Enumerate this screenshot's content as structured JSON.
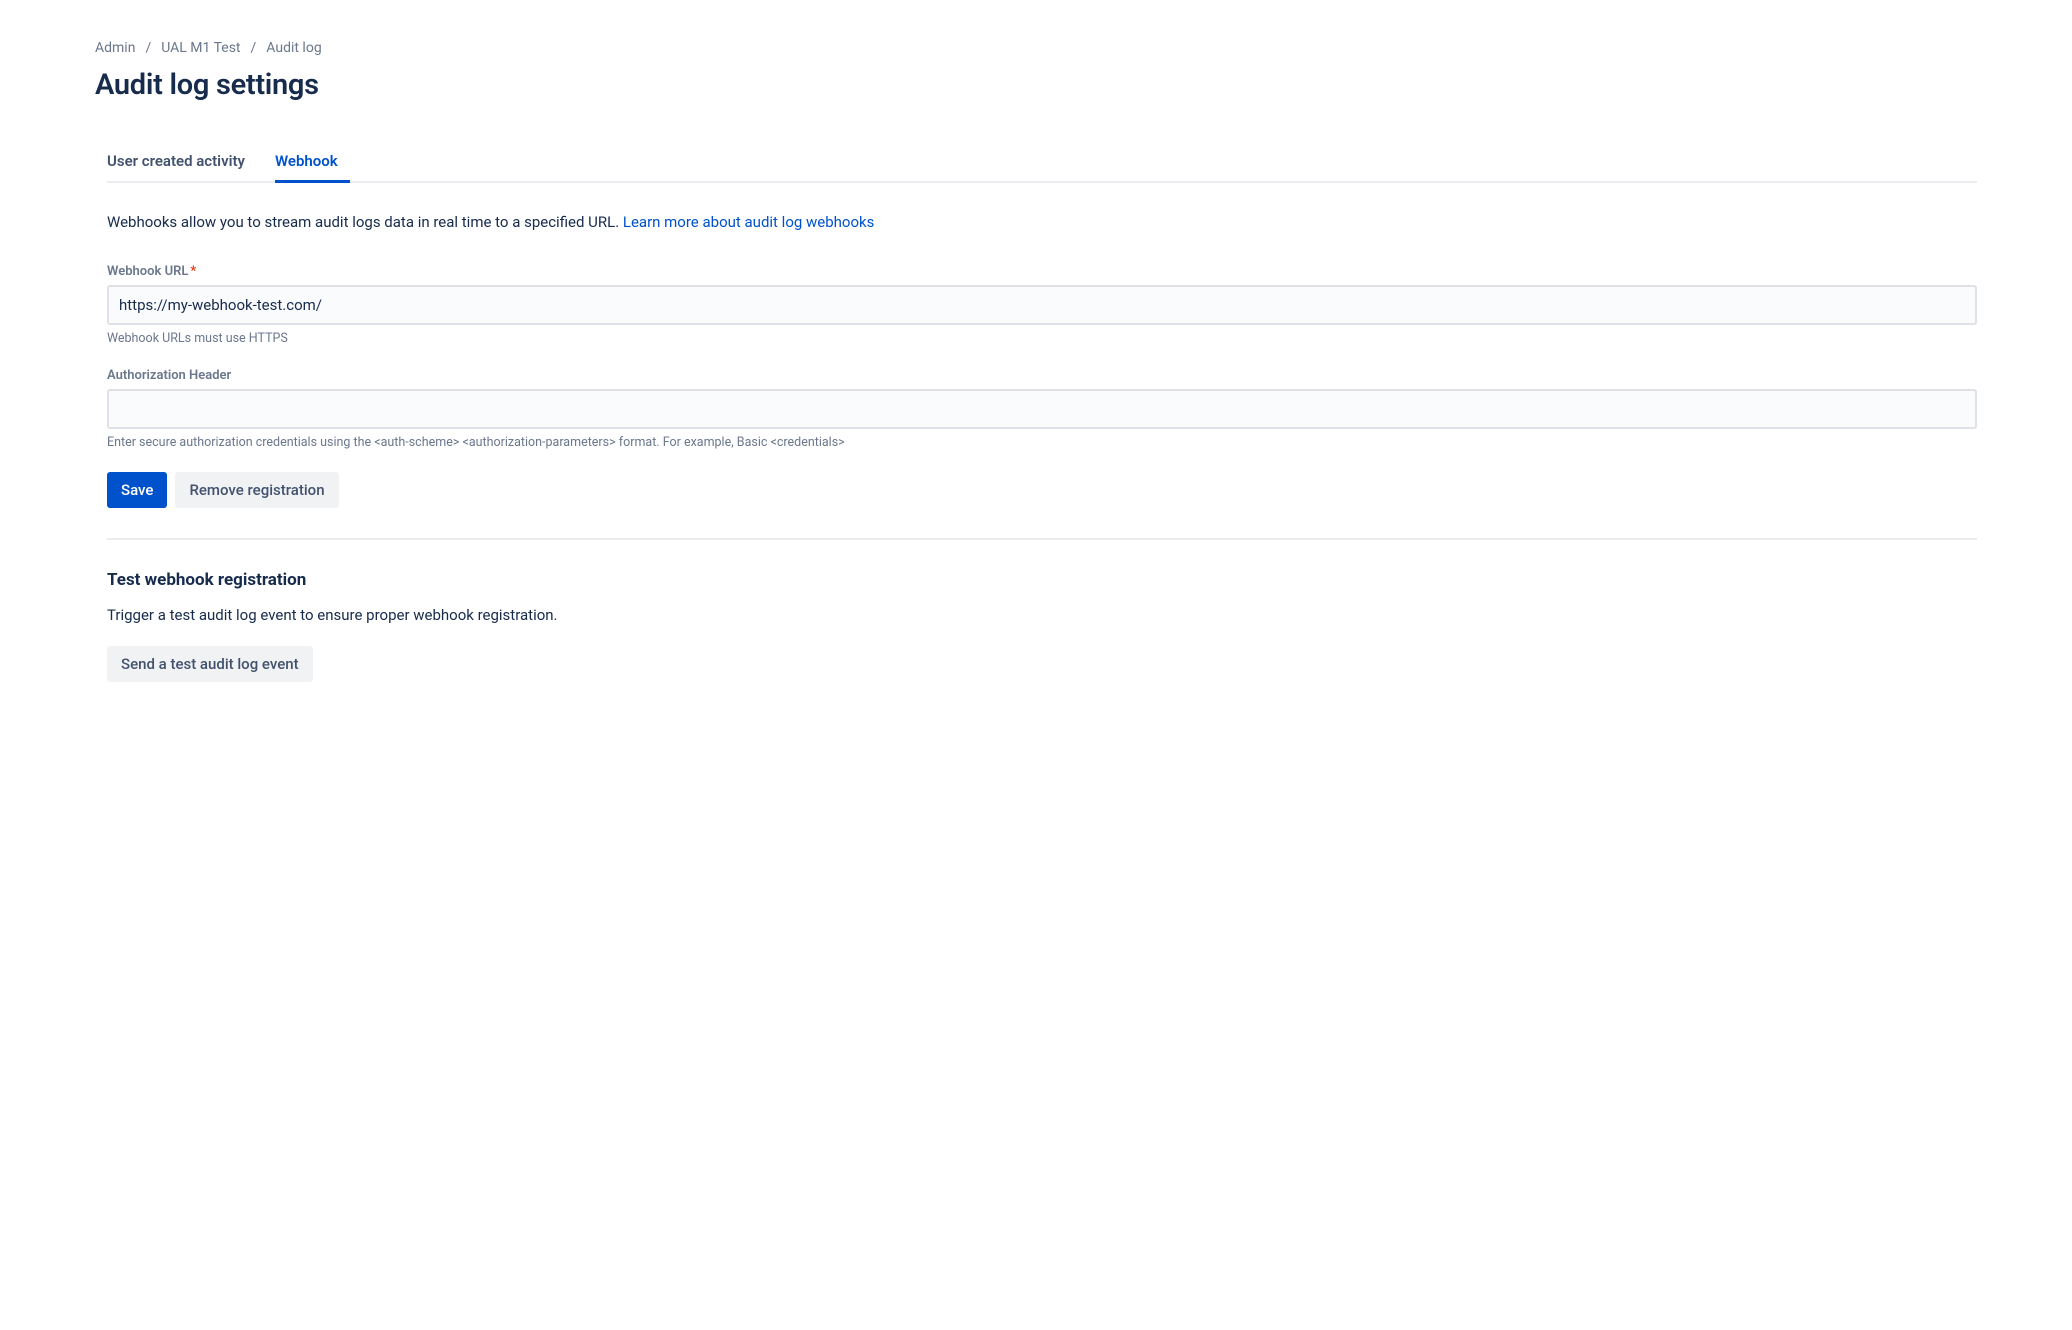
{
  "breadcrumbs": {
    "items": [
      {
        "label": "Admin"
      },
      {
        "label": "UAL M1 Test"
      },
      {
        "label": "Audit log"
      }
    ]
  },
  "page": {
    "title": "Audit log settings"
  },
  "tabs": {
    "items": [
      {
        "label": "User created activity"
      },
      {
        "label": "Webhook"
      }
    ],
    "active_index": 1
  },
  "intro": {
    "text": "Webhooks allow you to stream audit logs data in real time to a specified URL. ",
    "link_label": "Learn more about audit log webhooks"
  },
  "form": {
    "webhook_url": {
      "label": "Webhook URL",
      "required_marker": "*",
      "value": "https://my-webhook-test.com/",
      "helper": "Webhook URLs must use HTTPS"
    },
    "auth_header": {
      "label": "Authorization Header",
      "value": "",
      "helper": "Enter secure authorization credentials using the <auth-scheme> <authorization-parameters> format. For example, Basic <credentials>"
    },
    "save_label": "Save",
    "remove_label": "Remove registration"
  },
  "test_section": {
    "title": "Test webhook registration",
    "desc": "Trigger a test audit log event to ensure proper webhook registration.",
    "button_label": "Send a test audit log event"
  }
}
